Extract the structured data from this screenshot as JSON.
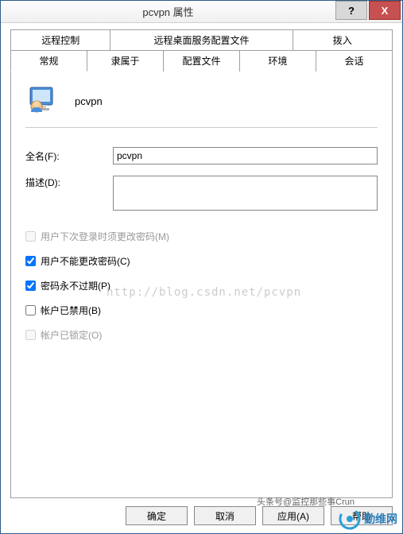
{
  "titlebar": {
    "title": "pcvpn 属性",
    "help": "?",
    "close": "X"
  },
  "tabs": {
    "back": [
      {
        "label": "远程控制"
      },
      {
        "label": "远程桌面服务配置文件"
      },
      {
        "label": "拨入"
      }
    ],
    "front": [
      {
        "label": "常规",
        "active": true
      },
      {
        "label": "隶属于"
      },
      {
        "label": "配置文件"
      },
      {
        "label": "环境"
      },
      {
        "label": "会话"
      }
    ]
  },
  "user": {
    "name": "pcvpn"
  },
  "form": {
    "fullname_label": "全名(F):",
    "fullname_value": "pcvpn",
    "description_label": "描述(D):",
    "description_value": ""
  },
  "checkboxes": [
    {
      "label": "用户下次登录时须更改密码(M)",
      "checked": false,
      "disabled": true
    },
    {
      "label": "用户不能更改密码(C)",
      "checked": true,
      "disabled": false
    },
    {
      "label": "密码永不过期(P)",
      "checked": true,
      "disabled": false
    },
    {
      "label": "帐户已禁用(B)",
      "checked": false,
      "disabled": false
    },
    {
      "label": "帐户已锁定(O)",
      "checked": false,
      "disabled": true
    }
  ],
  "watermark": "http://blog.csdn.net/pcvpn",
  "footer": {
    "ok": "确定",
    "cancel": "取消",
    "apply": "应用(A)",
    "help": "帮助"
  },
  "attribution": "头条号@监控那些事Crun",
  "brand": "勤维网"
}
